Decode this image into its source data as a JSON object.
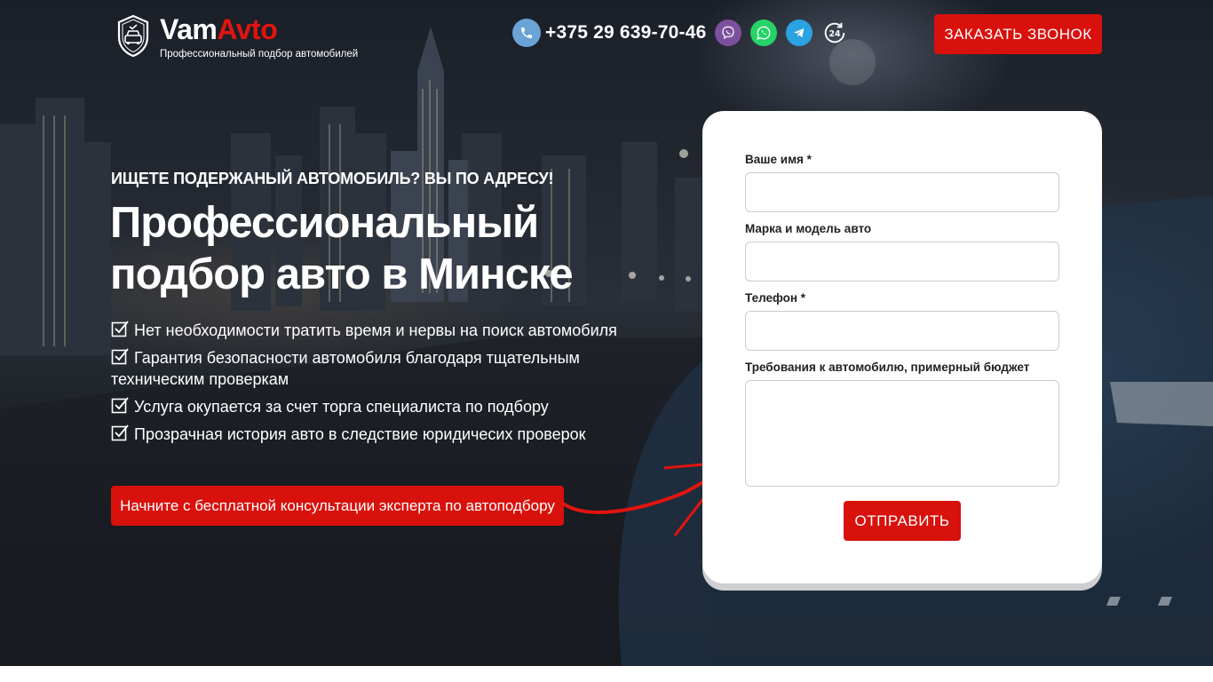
{
  "header": {
    "brand_part1": "Vam",
    "brand_part2": "Avto",
    "tagline": "Профессиональный подбор автомобилей",
    "phone": "+375 29 639-70-46",
    "messengers": [
      "viber-icon",
      "whatsapp-icon",
      "telegram-icon",
      "24h-support-icon"
    ],
    "callback_label": "ЗАКАЗАТЬ ЗВОНОК"
  },
  "hero": {
    "subtitle": "ИЩЕТЕ ПОДЕРЖАНЫЙ АВТОМОБИЛЬ? ВЫ ПО АДРЕСУ!",
    "title": "Профессиональный подбор авто в Минске",
    "features": [
      "Нет необходимости тратить время и нервы на поиск автомобиля",
      "Гарантия безопасности автомобиля благодаря тщательным техническим проверкам",
      "Услуга окупается за счет торга специалиста по подбору",
      "Прозрачная история авто в следствие юридичесих проверок"
    ],
    "consult_label": "Начните с бесплатной консультации эксперта по автоподбору"
  },
  "form": {
    "name_label": "Ваше имя *",
    "name_value": "",
    "model_label": "Марка и модель авто",
    "model_value": "",
    "phone_label": "Телефон *",
    "phone_value": "",
    "requirements_label": "Требования к автомобилю, примерный бюджет",
    "requirements_value": "",
    "submit_label": "ОТПРАВИТЬ"
  },
  "colors": {
    "accent": "#d8110d",
    "brand_red": "#e3140e",
    "phone_icon": "#6aa3d6",
    "viber": "#7b519d",
    "whatsapp": "#25d366",
    "telegram": "#2aa3e0"
  }
}
